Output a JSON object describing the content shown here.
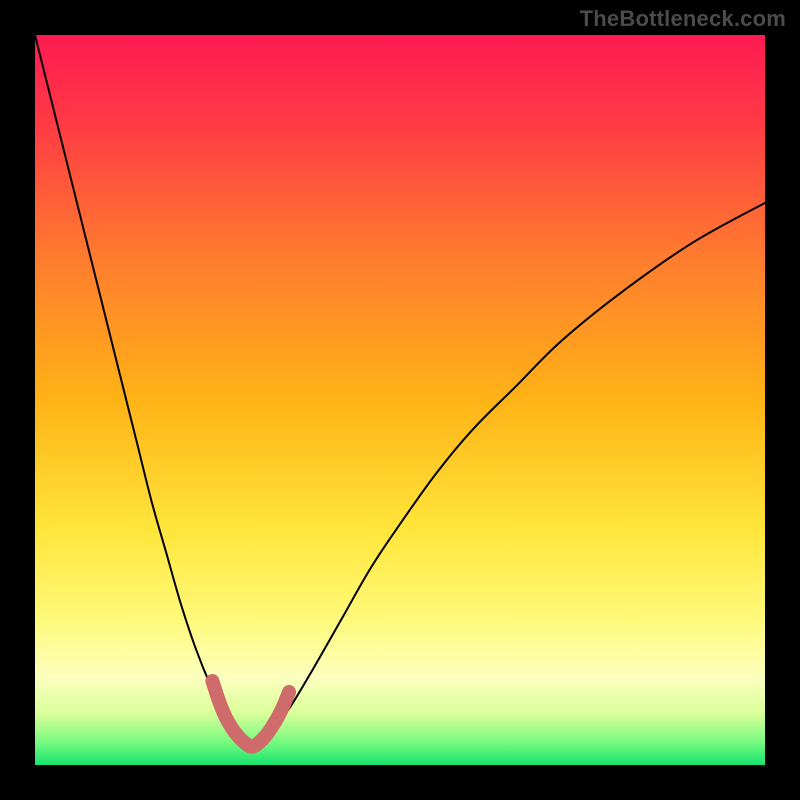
{
  "watermark": "TheBottleneck.com",
  "chart_data": {
    "type": "line",
    "title": "",
    "xlabel": "",
    "ylabel": "",
    "xlim": [
      0,
      100
    ],
    "ylim": [
      0,
      100
    ],
    "grid": false,
    "legend": false,
    "annotations": [],
    "background_gradient": {
      "stops": [
        {
          "offset": 0.0,
          "color": "#ff1a52"
        },
        {
          "offset": 0.12,
          "color": "#ff3a45"
        },
        {
          "offset": 0.3,
          "color": "#ff7a2f"
        },
        {
          "offset": 0.5,
          "color": "#ffb316"
        },
        {
          "offset": 0.68,
          "color": "#ffe63b"
        },
        {
          "offset": 0.8,
          "color": "#fff97a"
        },
        {
          "offset": 0.88,
          "color": "#fcffbe"
        },
        {
          "offset": 0.93,
          "color": "#d9ff9a"
        },
        {
          "offset": 0.97,
          "color": "#73f97e"
        },
        {
          "offset": 1.0,
          "color": "#15e36e"
        }
      ]
    },
    "series": [
      {
        "name": "bottleneck-curve",
        "color": "#000000",
        "stroke_width": 2,
        "x": [
          0,
          2,
          4,
          6,
          8,
          10,
          12,
          14,
          16,
          18,
          20,
          22,
          24,
          25.5,
          27,
          28.5,
          30,
          31.5,
          33,
          35,
          38,
          42,
          46,
          50,
          55,
          60,
          66,
          72,
          80,
          90,
          100
        ],
        "y": [
          100,
          92,
          84,
          76,
          68,
          60,
          52,
          44,
          36,
          29,
          22,
          16,
          11,
          8,
          5.5,
          3.8,
          2.5,
          3.6,
          5.2,
          8,
          13,
          20,
          27,
          33,
          40,
          46,
          52,
          58,
          64.5,
          71.5,
          77
        ]
      },
      {
        "name": "sweet-spot-marker",
        "color": "#cf6b6b",
        "stroke_width": 14,
        "linecap": "round",
        "x": [
          24.3,
          25.3,
          26.4,
          27.6,
          28.8,
          29.7,
          30.6,
          31.6,
          32.7,
          33.8,
          34.8
        ],
        "y": [
          11.5,
          8.5,
          6.0,
          4.2,
          3.0,
          2.5,
          3.0,
          4.0,
          5.6,
          7.6,
          10.0
        ]
      }
    ]
  }
}
